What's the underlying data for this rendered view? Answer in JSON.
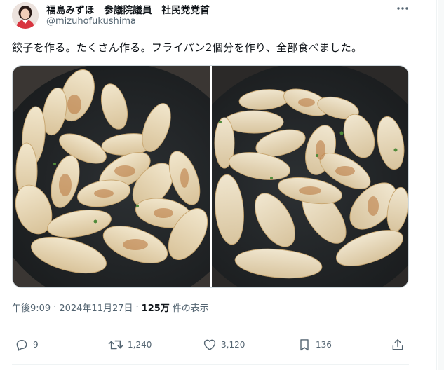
{
  "author": {
    "display_name": "福島みずほ　参議院議員　社民党党首",
    "handle": "@mizuhofukushima"
  },
  "tweet": {
    "text": "餃子を作る。たくさん作る。フライパン2個分を作り、全部食べました。"
  },
  "meta": {
    "time": "午後9:09",
    "dot1": "·",
    "date": "2024年11月27日",
    "dot2": "·",
    "views_count": "125万",
    "views_label": "件の表示"
  },
  "actions": {
    "replies": "9",
    "reposts": "1,240",
    "likes": "3,120",
    "bookmarks": "136"
  },
  "icons": {
    "more": "more-icon",
    "reply": "reply-icon",
    "repost": "repost-icon",
    "like": "heart-icon",
    "bookmark": "bookmark-icon",
    "share": "share-icon"
  },
  "colors": {
    "text": "#0f1419",
    "muted": "#536471",
    "divider": "#eff3f4",
    "pan": "#1f2224",
    "dumpling": "#e9dcc0",
    "browned": "#b8743a"
  }
}
